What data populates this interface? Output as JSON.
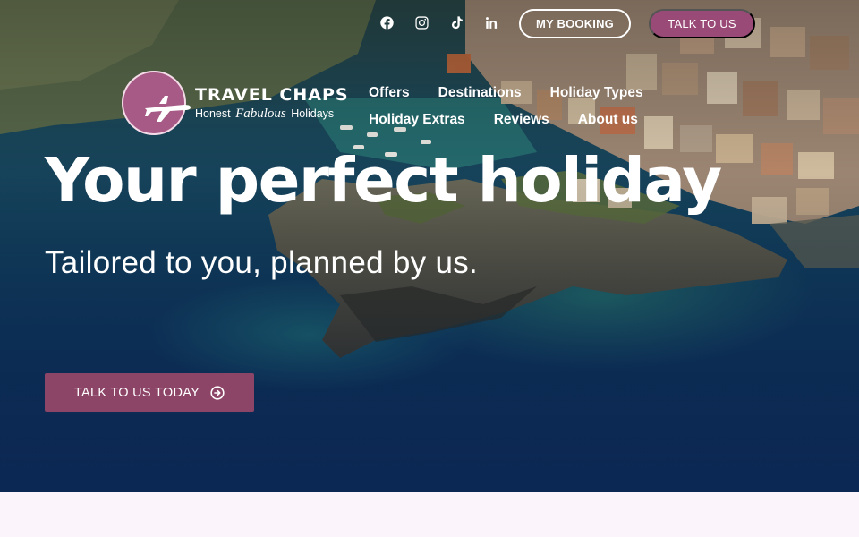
{
  "header": {
    "social": [
      {
        "name": "facebook-icon",
        "label": "Facebook"
      },
      {
        "name": "instagram-icon",
        "label": "Instagram"
      },
      {
        "name": "tiktok-icon",
        "label": "TikTok"
      },
      {
        "name": "linkedin-icon",
        "label": "LinkedIn"
      }
    ],
    "booking_label": "MY BOOKING",
    "talk_label": "TALK TO US"
  },
  "logo": {
    "title": "TRAVEL CHAPS",
    "tag_prefix": "Honest",
    "tag_emphasis": "Fabulous",
    "tag_suffix": "Holidays"
  },
  "nav": {
    "row1": [
      "Offers",
      "Destinations",
      "Holiday Types"
    ],
    "row2": [
      "Holiday Extras",
      "Reviews",
      "About us"
    ]
  },
  "hero": {
    "headline": "Your perfect holiday",
    "subhead": "Tailored to you, planned by us.",
    "cta_label": "TALK TO US TODAY",
    "cta_icon": "arrow-circle-right-icon"
  },
  "colors": {
    "accent": "#9a4a76",
    "cta": "#8c4467",
    "sea": "#0e3560",
    "page_bg": "#fbf5fb"
  }
}
